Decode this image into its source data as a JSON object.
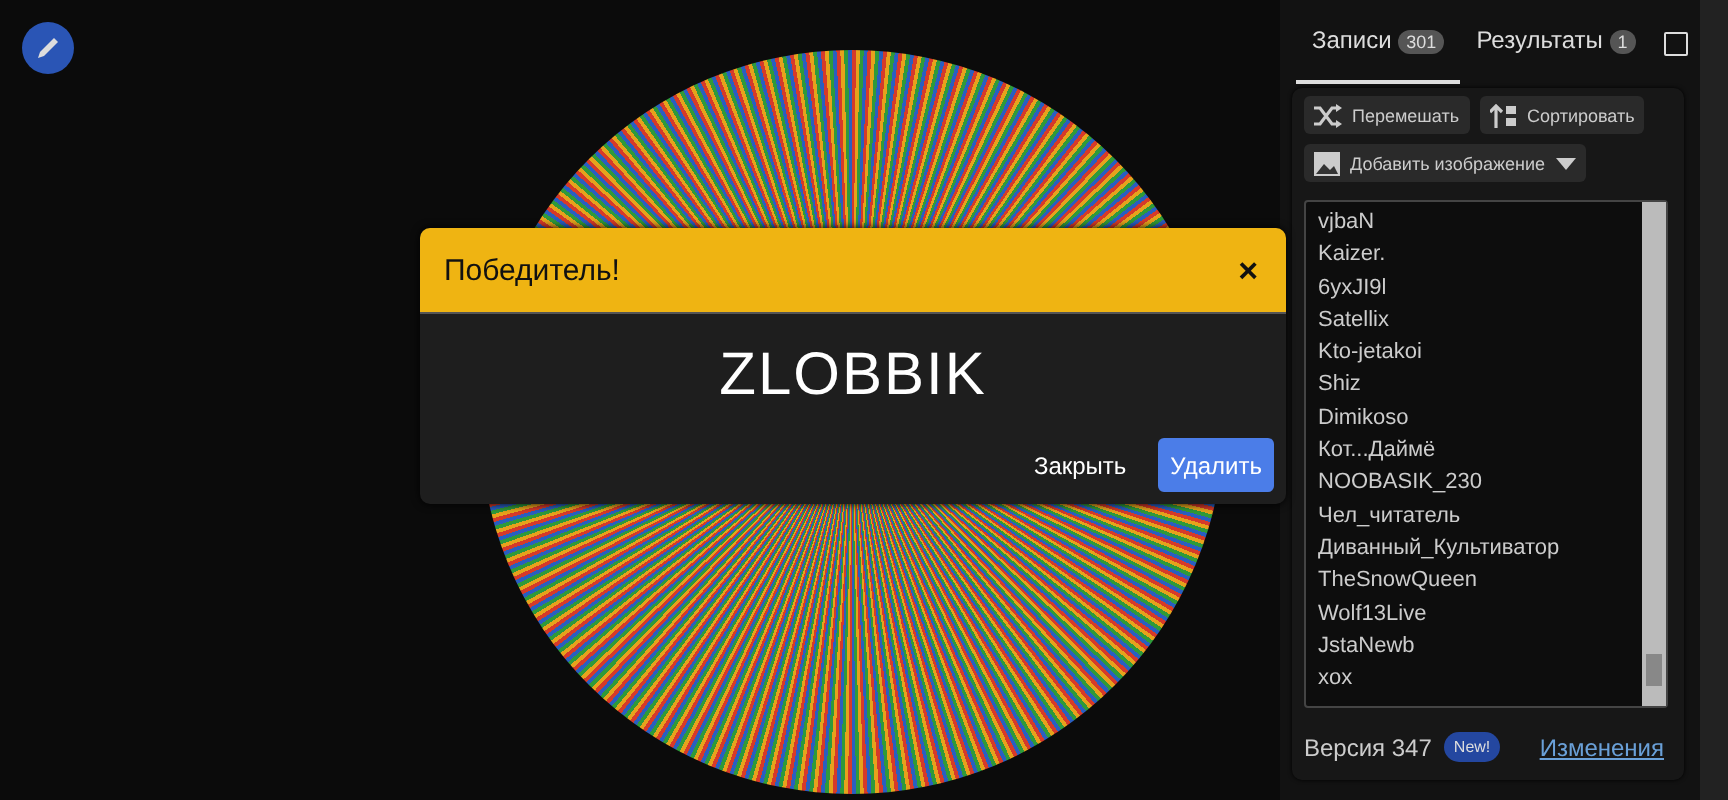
{
  "tabs": [
    {
      "label": "Записи",
      "count": "301",
      "selected": true
    },
    {
      "label": "Результаты",
      "count": "1",
      "selected": false
    }
  ],
  "tab_checkbox": {
    "checked": false
  },
  "actions": [
    {
      "label": "Перемешать",
      "kind": "shuffle"
    },
    {
      "label": "Сортировать",
      "kind": "sort"
    },
    {
      "label": "Добавить изображение",
      "kind": "image"
    }
  ],
  "entries": [
    "vjbaN",
    "Kaizer.",
    "6yxJI9l",
    "Satellix",
    "Kto-jetakoi",
    "Shiz",
    "Dimikoso",
    "Кот...Даймё",
    "NOOBASIK_230",
    "Чел_читатель",
    "Диванный_Культиватор",
    "TheSnowQueen",
    "Wolf13Live",
    "JstaNewb",
    "xox"
  ],
  "footer": {
    "version": "Версия 347",
    "badge": "New!",
    "link": "Изменения"
  },
  "dialog": {
    "title": "Победитель!",
    "close": "×",
    "winner": "ZLOBBIK",
    "buttons": [
      {
        "label": "Закрыть",
        "kind": "plain"
      },
      {
        "label": "Удалить",
        "kind": "primary"
      }
    ]
  }
}
